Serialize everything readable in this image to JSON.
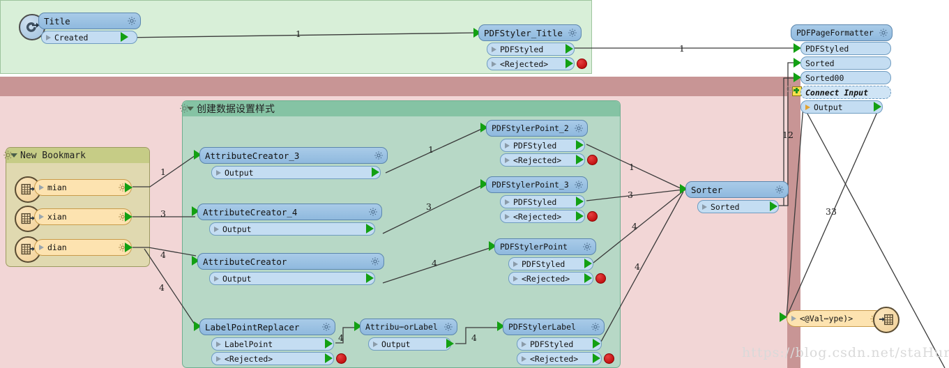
{
  "regions": {
    "top_green_group": {
      "name": "top-green-region"
    },
    "pink_group": {
      "name": "pink-region"
    },
    "teal_group": {
      "title": "创建数据设置样式"
    },
    "olive_group": {
      "title": "New Bookmark"
    }
  },
  "nodes": {
    "title": {
      "name": "Title",
      "ports": [
        "Created"
      ]
    },
    "pdfstyler_title": {
      "name": "PDFStyler_Title",
      "ports": [
        "PDFStyled",
        "<Rejected>"
      ]
    },
    "pdfpageformatter": {
      "name": "PDFPageFormatter",
      "ports": [
        "PDFStyled",
        "Sorted",
        "Sorted00",
        "Connect Input",
        "Output"
      ]
    },
    "bookmark_mian": {
      "name": "mian"
    },
    "bookmark_xian": {
      "name": "xian"
    },
    "bookmark_dian": {
      "name": "dian"
    },
    "attributecreator_3": {
      "name": "AttributeCreator_3",
      "ports": [
        "Output"
      ]
    },
    "attributecreator_4": {
      "name": "AttributeCreator_4",
      "ports": [
        "Output"
      ]
    },
    "attributecreator": {
      "name": "AttributeCreator",
      "ports": [
        "Output"
      ]
    },
    "labelpointreplacer": {
      "name": "LabelPointReplacer",
      "ports": [
        "LabelPoint",
        "<Rejected>"
      ]
    },
    "attribute_or_label": {
      "name": "Attribu⋯orLabel",
      "ports": [
        "Output"
      ]
    },
    "pdfstylerpoint_2": {
      "name": "PDFStylerPoint_2",
      "ports": [
        "PDFStyled",
        "<Rejected>"
      ]
    },
    "pdfstylerpoint_3": {
      "name": "PDFStylerPoint_3",
      "ports": [
        "PDFStyled",
        "<Rejected>"
      ]
    },
    "pdfstylerpoint": {
      "name": "PDFStylerPoint",
      "ports": [
        "PDFStyled",
        "<Rejected>"
      ]
    },
    "pdfstylerlabel": {
      "name": "PDFStylerLabel",
      "ports": [
        "PDFStyled",
        "<Rejected>"
      ]
    },
    "sorter": {
      "name": "Sorter",
      "ports": [
        "Sorted"
      ]
    },
    "writer": {
      "name": "<@Val⋯ype)>"
    }
  },
  "connection_labels": {
    "title_to_styler": "1",
    "styler_to_formatter": "1",
    "mian_to_ac3": "1",
    "xian_to_ac4": "3",
    "dian_to_ac": "4",
    "dian_to_lpr": "4",
    "ac3_to_point2": "1",
    "ac4_to_point3": "3",
    "ac_to_point": "4",
    "lpr_to_attr": "4",
    "attr_to_label": "4",
    "point2_to_sorter": "1",
    "point3_to_sorter": "3",
    "point_to_sorter": "4",
    "label_to_sorter": "4",
    "sorter_to_formatter": "12",
    "formatter_to_writer": "33"
  },
  "watermark": "https://blog.csdn.net/staHuri",
  "colors": {
    "node_header": "#8fb9de",
    "node_port": "#c4ddf2",
    "green_region": "#d8efd8",
    "pink_region": "#f2d6d6",
    "pink_header": "#c89595",
    "teal_group": "#b7d8c6",
    "olive_group": "#e0d9b0",
    "port_arrow": "#13a013",
    "rejected_dot": "#b50000"
  }
}
